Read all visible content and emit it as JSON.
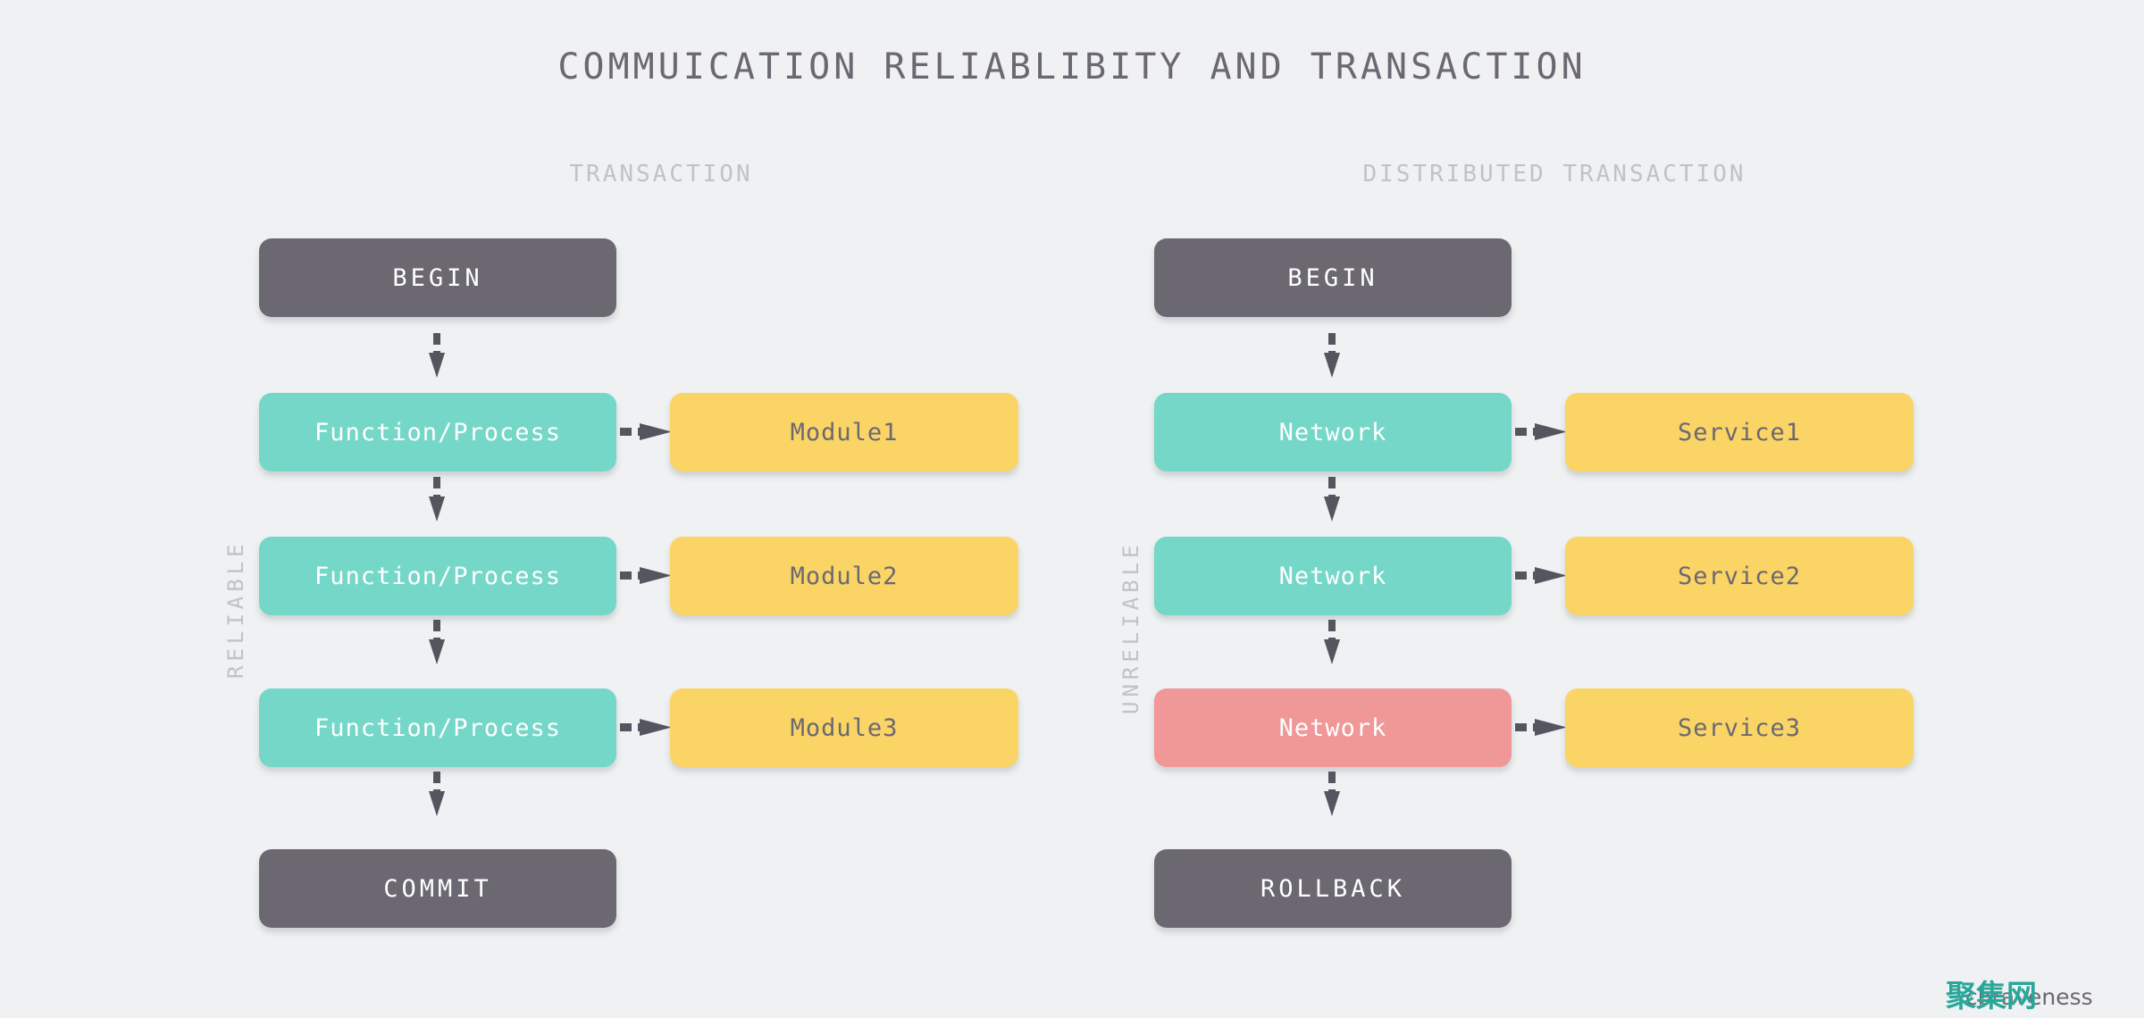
{
  "title": "COMMUICATION RELIABLIBITY AND TRANSACTION",
  "columns": {
    "left": {
      "header": "TRANSACTION",
      "side_label": "RELIABLE",
      "start": "BEGIN",
      "end": "COMMIT",
      "flow_nodes": [
        {
          "label": "Function/Process",
          "color": "#74d7c8",
          "state": "ok"
        },
        {
          "label": "Function/Process",
          "color": "#74d7c8",
          "state": "ok"
        },
        {
          "label": "Function/Process",
          "color": "#74d7c8",
          "state": "ok"
        }
      ],
      "side_nodes": [
        {
          "label": "Module1",
          "color": "#fad465"
        },
        {
          "label": "Module2",
          "color": "#fad465"
        },
        {
          "label": "Module3",
          "color": "#fad465"
        }
      ]
    },
    "right": {
      "header": "DISTRIBUTED TRANSACTION",
      "side_label": "UNRELIABLE",
      "start": "BEGIN",
      "end": "ROLLBACK",
      "flow_nodes": [
        {
          "label": "Network",
          "color": "#74d7c8",
          "state": "ok"
        },
        {
          "label": "Network",
          "color": "#74d7c8",
          "state": "ok"
        },
        {
          "label": "Network",
          "color": "#f09797",
          "state": "failed"
        }
      ],
      "side_nodes": [
        {
          "label": "Service1",
          "color": "#fad465"
        },
        {
          "label": "Service2",
          "color": "#fad465"
        },
        {
          "label": "Service3",
          "color": "#fad465"
        }
      ]
    }
  },
  "watermark": {
    "cjk": "聚集网",
    "latin": "cbraveness"
  },
  "colors": {
    "background": "#eff1f2",
    "dark": "#6b6872",
    "teal": "#74d7c8",
    "yellow": "#fad465",
    "salmon": "#f09797",
    "muted_text": "#bfc3c7",
    "arrow": "#555560"
  }
}
